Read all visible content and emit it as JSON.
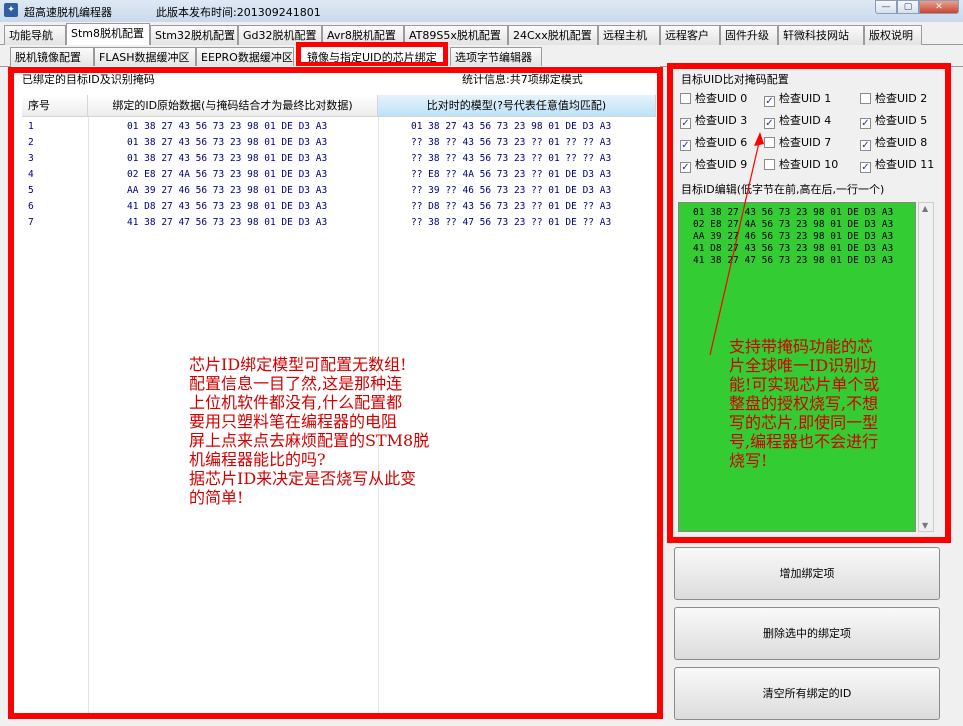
{
  "window": {
    "title": "超高速脱机编程器",
    "release_text": "此版本发布时间:201309241801",
    "min": "—",
    "max": "▢",
    "close": "✕"
  },
  "tabs_row1": [
    "功能导航",
    "Stm8脱机配置",
    "Stm32脱机配置",
    "Gd32脱机配置",
    "Avr8脱机配置",
    "AT89S5x脱机配置",
    "24Cxx脱机配置",
    "远程主机",
    "远程客户",
    "固件升级",
    "轩微科技网站",
    "版权说明"
  ],
  "tabs_row2": [
    "脱机镜像配置",
    "FLASH数据缓冲区",
    "EEPRO数据缓冲区",
    "镜像与指定UID的芯片绑定",
    "选项字节编辑器"
  ],
  "left": {
    "group_title": "已绑定的目标ID及识别掩码",
    "stats": "统计信息:共7项绑定模式",
    "columns": [
      "序号",
      "绑定的ID原始数据(与掩码结合才为最终比对数据)",
      "比对时的模型(?号代表任意值均匹配)"
    ],
    "rows": [
      {
        "no": "1",
        "raw": "01 38 27 43 56 73 23 98 01 DE D3 A3",
        "model": "01 38 27 43 56 73 23 98 01 DE D3 A3"
      },
      {
        "no": "2",
        "raw": "01 38 27 43 56 73 23 98 01 DE D3 A3",
        "model": "?? 38 ?? 43 56 73 23 ?? 01 ?? ?? A3"
      },
      {
        "no": "3",
        "raw": "01 38 27 43 56 73 23 98 01 DE D3 A3",
        "model": "?? 38 ?? 43 56 73 23 ?? 01 ?? ?? A3"
      },
      {
        "no": "4",
        "raw": "02 E8 27 4A 56 73 23 98 01 DE D3 A3",
        "model": "?? E8 ?? 4A 56 73 23 ?? 01 DE D3 A3"
      },
      {
        "no": "5",
        "raw": "AA 39 27 46 56 73 23 98 01 DE D3 A3",
        "model": "?? 39 ?? 46 56 73 23 ?? 01 DE D3 A3"
      },
      {
        "no": "6",
        "raw": "41 D8 27 43 56 73 23 98 01 DE D3 A3",
        "model": "?? D8 ?? 43 56 73 23 ?? 01 DE ?? A3"
      },
      {
        "no": "7",
        "raw": "41 38 27 47 56 73 23 98 01 DE D3 A3",
        "model": "?? 38 ?? 47 56 73 23 ?? 01 DE ?? A3"
      }
    ],
    "annotation": [
      "芯片ID绑定模型可配置无数组!",
      "配置信息一目了然,这是那种连",
      "上位机软件都没有,什么配置都",
      "要用只塑料笔在编程器的电阻",
      "屏上点来点去麻烦配置的STM8脱",
      "机编程器能比的吗?",
      "据芯片ID来决定是否烧写从此变",
      "的简单!"
    ]
  },
  "right": {
    "mask_title": "目标UID比对掩码配置",
    "checks": [
      {
        "label": "检查UID 0",
        "checked": false
      },
      {
        "label": "检查UID 1",
        "checked": true
      },
      {
        "label": "检查UID 2",
        "checked": false
      },
      {
        "label": "检查UID 3",
        "checked": true
      },
      {
        "label": "检查UID 4",
        "checked": true
      },
      {
        "label": "检查UID 5",
        "checked": true
      },
      {
        "label": "检查UID 6",
        "checked": true
      },
      {
        "label": "检查UID 7",
        "checked": false
      },
      {
        "label": "检查UID 8",
        "checked": true
      },
      {
        "label": "检查UID 9",
        "checked": true
      },
      {
        "label": "检查UID 10",
        "checked": false
      },
      {
        "label": "检查UID 11",
        "checked": true
      }
    ],
    "editor_title": "目标ID编辑(低字节在前,高在后,一行一个)",
    "editor_lines": [
      "01 38 27 43 56 73 23 98 01 DE D3 A3",
      "02 E8 27 4A 56 73 23 98 01 DE D3 A3",
      "AA 39 27 46 56 73 23 98 01 DE D3 A3",
      "41 D8 27 43 56 73 23 98 01 DE D3 A3",
      "41 38 27 47 56 73 23 98 01 DE D3 A3"
    ],
    "annotation": [
      "支持带掩码功能的芯",
      "片全球唯一ID识别功",
      "能!可实现芯片单个或",
      "整盘的授权烧写,不想",
      "写的芯片,即使同一型",
      "号,编程器也不会进行",
      "烧写!"
    ],
    "buttons": {
      "add": "增加绑定项",
      "delete": "删除选中的绑定项",
      "clear": "清空所有绑定的ID"
    }
  },
  "colors": {
    "highlight": "#ff0000",
    "editor_bg": "#33cc33",
    "annotation": "#d40000",
    "cell_text": "#000080"
  }
}
